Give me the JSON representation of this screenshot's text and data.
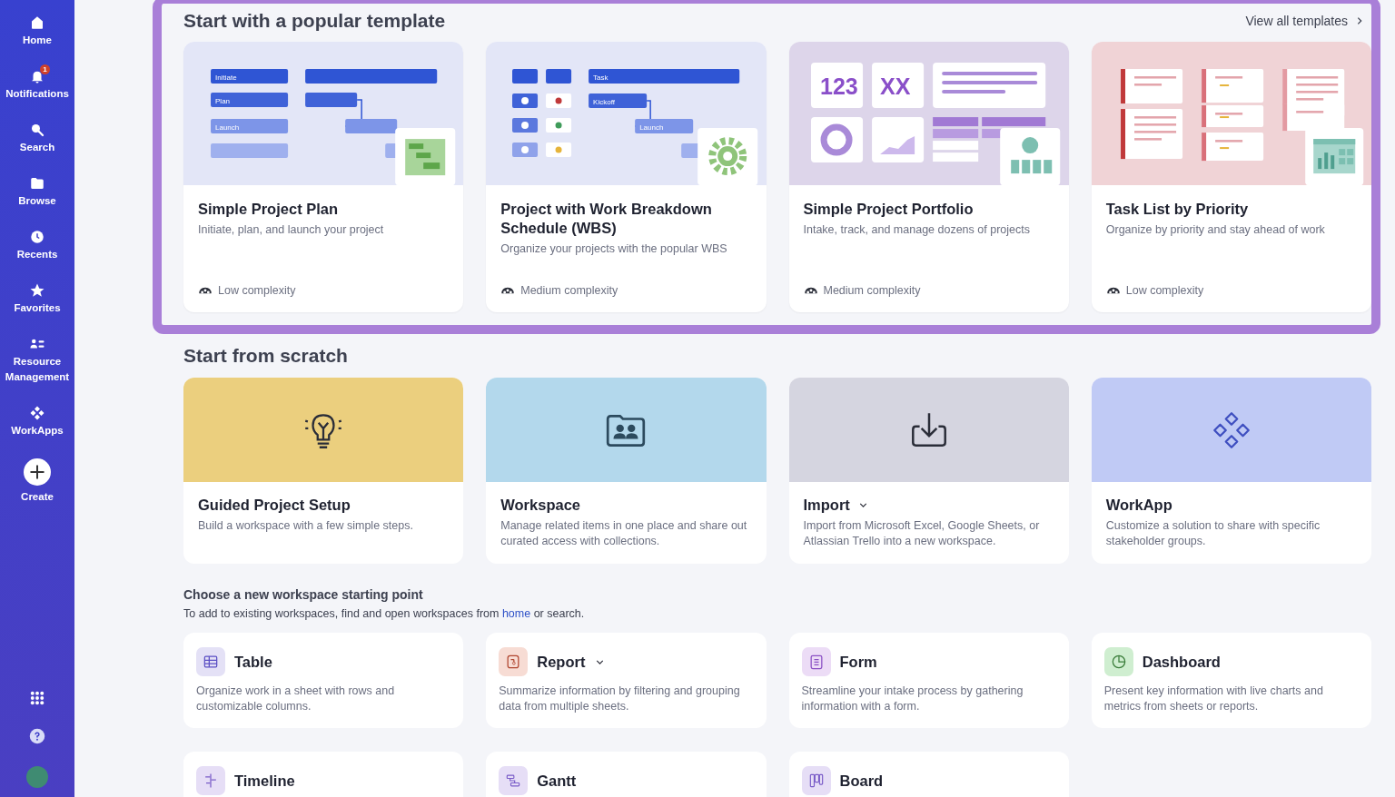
{
  "sidebar": {
    "items": [
      {
        "kind": "home",
        "label": "Home"
      },
      {
        "kind": "bell",
        "label": "Notifications",
        "badge": "1"
      },
      {
        "kind": "search",
        "label": "Search"
      },
      {
        "kind": "folder",
        "label": "Browse"
      },
      {
        "kind": "clock",
        "label": "Recents"
      },
      {
        "kind": "star",
        "label": "Favorites"
      },
      {
        "kind": "people",
        "label": "Resource Management"
      },
      {
        "kind": "workapps",
        "label": "WorkApps"
      },
      {
        "kind": "create",
        "label": "Create"
      }
    ]
  },
  "templates": {
    "title": "Start with a popular template",
    "view_all": "View all templates",
    "cards": [
      {
        "kind": "gantt",
        "labels": [
          "Initiate",
          "Plan",
          "Launch"
        ],
        "title": "Simple Project Plan",
        "description": "Initiate, plan, and launch your project",
        "complexity": "Low complexity"
      },
      {
        "kind": "wbs",
        "labels": [
          "Task",
          "Kickoff",
          "Launch"
        ],
        "title": "Project with Work Breakdown Schedule (WBS)",
        "description": "Organize your projects with the popular WBS",
        "complexity": "Medium complexity"
      },
      {
        "kind": "portfolio",
        "labels": [
          "123",
          "XX"
        ],
        "title": "Simple Project Portfolio",
        "description": "Intake, track, and manage dozens of projects",
        "complexity": "Medium complexity"
      },
      {
        "kind": "tasklist",
        "title": "Task List by Priority",
        "description": "Organize by priority and stay ahead of work",
        "complexity": "Low complexity"
      }
    ]
  },
  "scratch": {
    "title": "Start from scratch",
    "cards": [
      {
        "kind": "guided",
        "title": "Guided Project Setup",
        "description": "Build a workspace with a few simple steps.",
        "dropdown": false
      },
      {
        "kind": "workspace",
        "title": "Workspace",
        "description": "Manage related items in one place and share out curated access with collections.",
        "dropdown": false
      },
      {
        "kind": "import",
        "title": "Import",
        "description": "Import from Microsoft Excel, Google Sheets, or Atlassian Trello into a new workspace.",
        "dropdown": true
      },
      {
        "kind": "workapp",
        "title": "WorkApp",
        "description": "Customize a solution to share with specific stakeholder groups.",
        "dropdown": false
      }
    ]
  },
  "starting_point": {
    "title": "Choose a new workspace starting point",
    "hint": {
      "before": "To add to existing workspaces, find and open workspaces from ",
      "link": "home",
      "after": " or search."
    },
    "items": [
      {
        "kind": "table",
        "title": "Table",
        "description": "Organize work in a sheet with rows and customizable columns.",
        "dropdown": false
      },
      {
        "kind": "report",
        "title": "Report",
        "description": "Summarize information by filtering and grouping data from multiple sheets.",
        "dropdown": true
      },
      {
        "kind": "form",
        "title": "Form",
        "description": "Streamline your intake process by gathering information with a form.",
        "dropdown": false
      },
      {
        "kind": "dashboard",
        "title": "Dashboard",
        "description": "Present key information with live charts and metrics from sheets or reports.",
        "dropdown": false
      },
      {
        "kind": "timeline",
        "title": "Timeline",
        "dropdown": false
      },
      {
        "kind": "gantt",
        "title": "Gantt",
        "dropdown": false
      },
      {
        "kind": "board",
        "title": "Board",
        "dropdown": false
      }
    ]
  }
}
